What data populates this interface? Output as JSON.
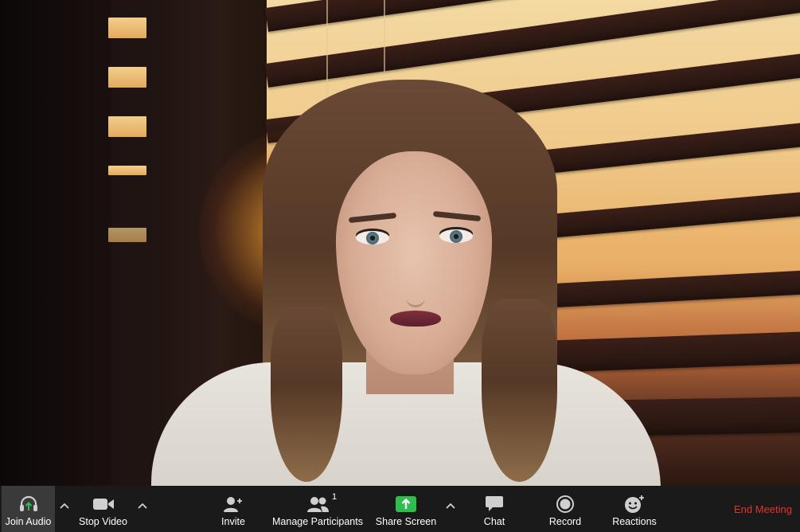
{
  "toolbar": {
    "join_audio": {
      "label": "Join Audio",
      "icon": "headphones-icon"
    },
    "stop_video": {
      "label": "Stop Video",
      "icon": "video-camera-icon"
    },
    "invite": {
      "label": "Invite",
      "icon": "add-person-icon"
    },
    "manage_participants": {
      "label": "Manage Participants",
      "icon": "participants-icon",
      "count": "1"
    },
    "share_screen": {
      "label": "Share Screen",
      "icon": "share-screen-icon",
      "color": "#2dbe4e"
    },
    "chat": {
      "label": "Chat",
      "icon": "chat-bubble-icon"
    },
    "record": {
      "label": "Record",
      "icon": "record-icon"
    },
    "reactions": {
      "label": "Reactions",
      "icon": "smiley-add-icon"
    },
    "end_meeting": {
      "label": "End Meeting",
      "color": "#e8312d"
    }
  }
}
